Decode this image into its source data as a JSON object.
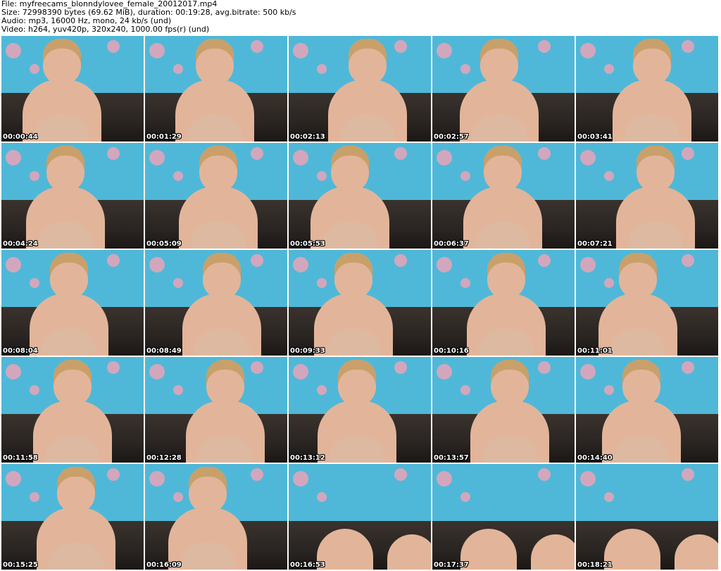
{
  "header": {
    "line1": "File: myfreecams_blonndylovee_female_20012017.mp4",
    "line2": "Size: 72998390 bytes (69.62 MiB), duration: 00:19:28, avg.bitrate: 500 kb/s",
    "line3": "Audio: mp3, 16000 Hz, mono, 24 kb/s (und)",
    "line4": "Video: h264, yuv420p, 320x240, 1000.00 fps(r) (und)"
  },
  "colors": {
    "wall": "#4fb8d8",
    "couch": "#2a2522",
    "skin": "#e2b59a",
    "hair": "#c9a06a",
    "flower": "#e9a3b8",
    "bra": "#dcb9a0"
  },
  "thumbnails": [
    {
      "timestamp": "00:00:44",
      "subject": "person"
    },
    {
      "timestamp": "00:01:29",
      "subject": "person"
    },
    {
      "timestamp": "00:02:13",
      "subject": "person"
    },
    {
      "timestamp": "00:02:57",
      "subject": "person"
    },
    {
      "timestamp": "00:03:41",
      "subject": "person"
    },
    {
      "timestamp": "00:04:24",
      "subject": "person"
    },
    {
      "timestamp": "00:05:09",
      "subject": "person"
    },
    {
      "timestamp": "00:05:53",
      "subject": "person"
    },
    {
      "timestamp": "00:06:37",
      "subject": "person"
    },
    {
      "timestamp": "00:07:21",
      "subject": "person"
    },
    {
      "timestamp": "00:08:04",
      "subject": "person"
    },
    {
      "timestamp": "00:08:49",
      "subject": "person"
    },
    {
      "timestamp": "00:09:33",
      "subject": "person"
    },
    {
      "timestamp": "00:10:16",
      "subject": "person"
    },
    {
      "timestamp": "00:11:01",
      "subject": "person"
    },
    {
      "timestamp": "00:11:58",
      "subject": "person"
    },
    {
      "timestamp": "00:12:28",
      "subject": "person"
    },
    {
      "timestamp": "00:13:12",
      "subject": "person"
    },
    {
      "timestamp": "00:13:57",
      "subject": "person"
    },
    {
      "timestamp": "00:14:40",
      "subject": "person"
    },
    {
      "timestamp": "00:15:25",
      "subject": "person"
    },
    {
      "timestamp": "00:16:09",
      "subject": "person"
    },
    {
      "timestamp": "00:16:53",
      "subject": "legs"
    },
    {
      "timestamp": "00:17:37",
      "subject": "legs"
    },
    {
      "timestamp": "00:18:21",
      "subject": "legs"
    }
  ]
}
